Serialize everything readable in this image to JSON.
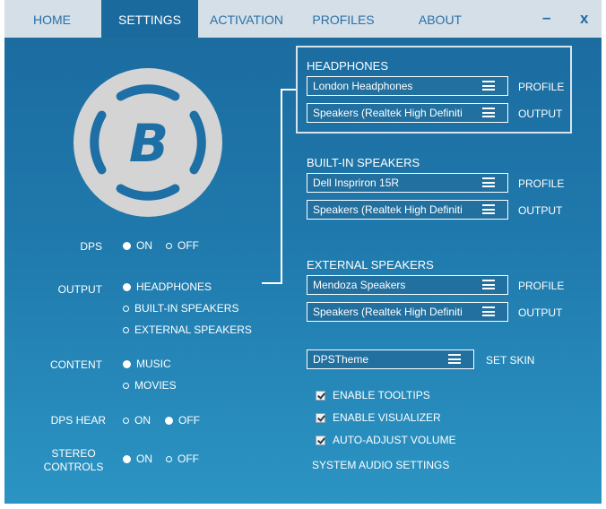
{
  "tabs": [
    {
      "label": "HOME"
    },
    {
      "label": "SETTINGS"
    },
    {
      "label": "ACTIVATION"
    },
    {
      "label": "PROFILES"
    },
    {
      "label": "ABOUT"
    }
  ],
  "window": {
    "minimize": "–",
    "close": "x"
  },
  "logo": {
    "letter": "B"
  },
  "left": {
    "dps": {
      "label": "DPS",
      "on": "ON",
      "off": "OFF",
      "selected": "ON"
    },
    "output": {
      "label": "OUTPUT",
      "options": [
        "HEADPHONES",
        "BUILT-IN SPEAKERS",
        "EXTERNAL SPEAKERS"
      ],
      "selected": "HEADPHONES"
    },
    "content": {
      "label": "CONTENT",
      "options": [
        "MUSIC",
        "MOVIES"
      ],
      "selected": "MUSIC"
    },
    "dps_hear": {
      "label": "DPS HEAR",
      "on": "ON",
      "off": "OFF",
      "selected": "OFF"
    },
    "stereo": {
      "label_line1": "STEREO",
      "label_line2": "CONTROLS",
      "on": "ON",
      "off": "OFF",
      "selected": "ON"
    }
  },
  "sections": {
    "headphones": {
      "title": "HEADPHONES",
      "profile_value": "London Headphones",
      "profile_label": "PROFILE",
      "output_value": "Speakers (Realtek High Definiti",
      "output_label": "OUTPUT"
    },
    "builtin": {
      "title": "BUILT-IN SPEAKERS",
      "profile_value": "Dell Inspriron 15R",
      "profile_label": "PROFILE",
      "output_value": "Speakers (Realtek High Definiti",
      "output_label": "OUTPUT"
    },
    "external": {
      "title": "EXTERNAL SPEAKERS",
      "profile_value": "Mendoza Speakers",
      "profile_label": "PROFILE",
      "output_value": "Speakers (Realtek High Definiti",
      "output_label": "OUTPUT"
    }
  },
  "skin": {
    "value": "DPSTheme",
    "label": "SET SKIN"
  },
  "checkboxes": [
    {
      "label": "ENABLE TOOLTIPS",
      "checked": true
    },
    {
      "label": "ENABLE VISUALIZER",
      "checked": true
    },
    {
      "label": "AUTO-ADJUST VOLUME",
      "checked": true
    }
  ],
  "system_audio": "SYSTEM AUDIO SETTINGS"
}
